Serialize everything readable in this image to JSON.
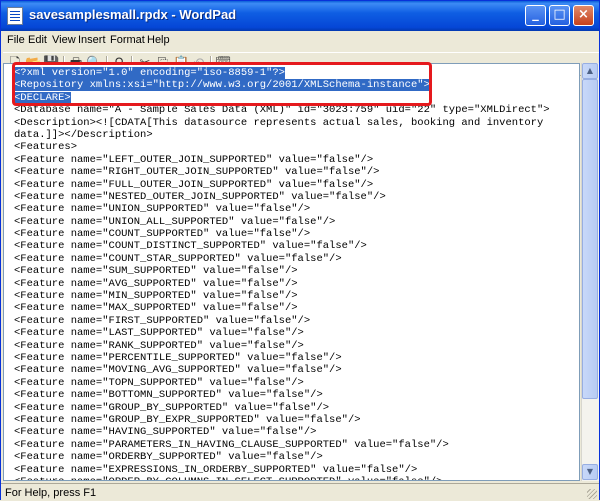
{
  "window": {
    "title": "savesamplesmall.rpdx - WordPad",
    "minimize_glyph": "_",
    "maximize_glyph": "□",
    "close_glyph": "×"
  },
  "menubar": {
    "items": [
      "File",
      "Edit",
      "View",
      "Insert",
      "Format",
      "Help"
    ]
  },
  "toolbar": {
    "icons": [
      "new-icon",
      "open-icon",
      "save-icon",
      "print-icon",
      "print-preview-icon",
      "find-icon",
      "cut-icon",
      "copy-icon",
      "paste-icon",
      "undo-icon",
      "date-time-icon"
    ]
  },
  "document": {
    "lines": [
      "<?xml version=\"1.0\" encoding=\"iso-8859-1\"?>",
      "<Repository xmlns:xsi=\"http://www.w3.org/2001/XMLSchema-instance\">",
      "<DECLARE>",
      "<Database name=\"A - Sample Sales Data (XML)\" id=\"3023:759\" uid=\"22\" type=\"XMLDirect\">",
      "<Description><![CDATA[This datasource represents actual sales, booking and inventory",
      "data.]]></Description>",
      "<Features>",
      "<Feature name=\"LEFT_OUTER_JOIN_SUPPORTED\" value=\"false\"/>",
      "<Feature name=\"RIGHT_OUTER_JOIN_SUPPORTED\" value=\"false\"/>",
      "<Feature name=\"FULL_OUTER_JOIN_SUPPORTED\" value=\"false\"/>",
      "<Feature name=\"NESTED_OUTER_JOIN_SUPPORTED\" value=\"false\"/>",
      "<Feature name=\"UNION_SUPPORTED\" value=\"false\"/>",
      "<Feature name=\"UNION_ALL_SUPPORTED\" value=\"false\"/>",
      "<Feature name=\"COUNT_SUPPORTED\" value=\"false\"/>",
      "<Feature name=\"COUNT_DISTINCT_SUPPORTED\" value=\"false\"/>",
      "<Feature name=\"COUNT_STAR_SUPPORTED\" value=\"false\"/>",
      "<Feature name=\"SUM_SUPPORTED\" value=\"false\"/>",
      "<Feature name=\"AVG_SUPPORTED\" value=\"false\"/>",
      "<Feature name=\"MIN_SUPPORTED\" value=\"false\"/>",
      "<Feature name=\"MAX_SUPPORTED\" value=\"false\"/>",
      "<Feature name=\"FIRST_SUPPORTED\" value=\"false\"/>",
      "<Feature name=\"LAST_SUPPORTED\" value=\"false\"/>",
      "<Feature name=\"RANK_SUPPORTED\" value=\"false\"/>",
      "<Feature name=\"PERCENTILE_SUPPORTED\" value=\"false\"/>",
      "<Feature name=\"MOVING_AVG_SUPPORTED\" value=\"false\"/>",
      "<Feature name=\"TOPN_SUPPORTED\" value=\"false\"/>",
      "<Feature name=\"BOTTOMN_SUPPORTED\" value=\"false\"/>",
      "<Feature name=\"GROUP_BY_SUPPORTED\" value=\"false\"/>",
      "<Feature name=\"GROUP_BY_EXPR_SUPPORTED\" value=\"false\"/>",
      "<Feature name=\"HAVING_SUPPORTED\" value=\"false\"/>",
      "<Feature name=\"PARAMETERS_IN_HAVING_CLAUSE_SUPPORTED\" value=\"false\"/>",
      "<Feature name=\"ORDERBY_SUPPORTED\" value=\"false\"/>",
      "<Feature name=\"EXPRESSIONS_IN_ORDERBY_SUPPORTED\" value=\"false\"/>",
      "<Feature name=\"ORDER_BY_COLUMNS_IN_SELECT_SUPPORTED\" value=\"false\"/>"
    ],
    "selected_line_count": 3
  },
  "statusbar": {
    "text": "For Help, press F1"
  }
}
